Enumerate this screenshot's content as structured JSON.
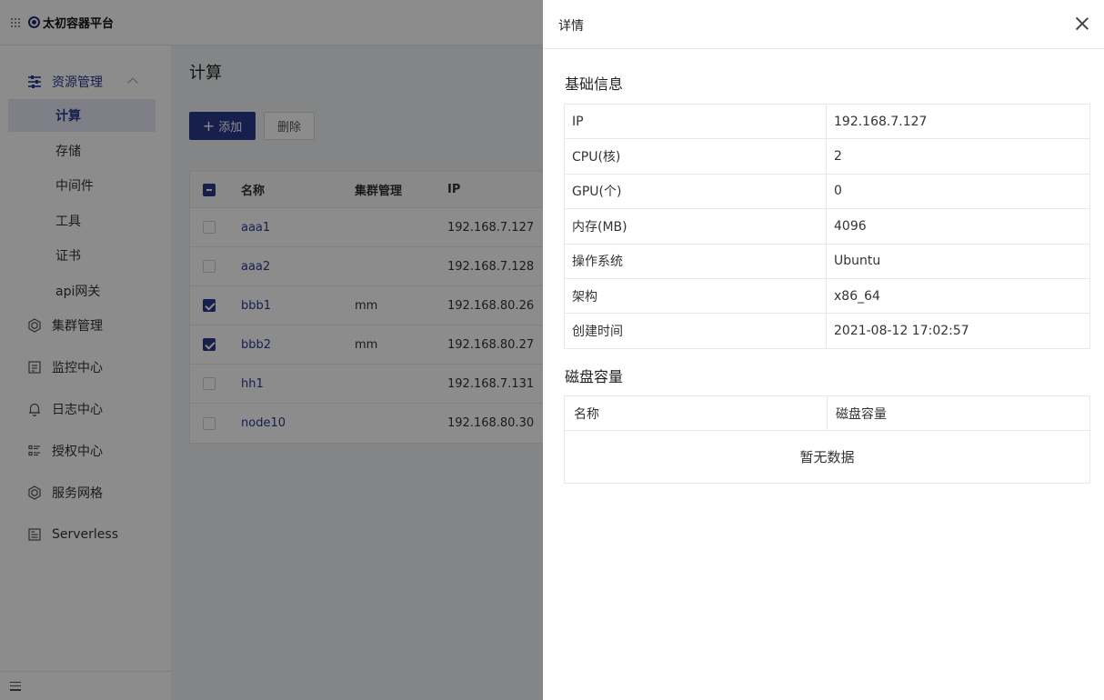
{
  "app": {
    "title": "太初容器平台"
  },
  "sidebar": {
    "groups": [
      {
        "label": "资源管理",
        "icon": "sliders-icon",
        "expanded": true
      },
      {
        "label": "集群管理",
        "icon": "hexagon-icon"
      },
      {
        "label": "监控中心",
        "icon": "monitor-icon"
      },
      {
        "label": "日志中心",
        "icon": "bell-icon"
      },
      {
        "label": "授权中心",
        "icon": "list-icon"
      },
      {
        "label": "服务网格",
        "icon": "hexagon-icon"
      },
      {
        "label": "Serverless",
        "icon": "document-icon"
      }
    ],
    "sub_items": [
      {
        "label": "计算",
        "active": true
      },
      {
        "label": "存储"
      },
      {
        "label": "中间件"
      },
      {
        "label": "工具"
      },
      {
        "label": "证书"
      },
      {
        "label": "api网关"
      }
    ]
  },
  "main": {
    "title": "计算",
    "add_button": "添加",
    "delete_button": "删除",
    "table": {
      "headers": [
        "名称",
        "集群管理",
        "IP"
      ],
      "rows": [
        {
          "name": "aaa1",
          "cluster": "",
          "ip": "192.168.7.127",
          "checked": false
        },
        {
          "name": "aaa2",
          "cluster": "",
          "ip": "192.168.7.128",
          "checked": false
        },
        {
          "name": "bbb1",
          "cluster": "mm",
          "ip": "192.168.80.26",
          "checked": true
        },
        {
          "name": "bbb2",
          "cluster": "mm",
          "ip": "192.168.80.27",
          "checked": true
        },
        {
          "name": "hh1",
          "cluster": "",
          "ip": "192.168.7.131",
          "checked": false
        },
        {
          "name": "node10",
          "cluster": "",
          "ip": "192.168.80.30",
          "checked": false
        }
      ]
    }
  },
  "drawer": {
    "title": "详情",
    "basic_title": "基础信息",
    "basic": [
      {
        "key": "IP",
        "value": "192.168.7.127"
      },
      {
        "key": "CPU(核)",
        "value": "2"
      },
      {
        "key": "GPU(个)",
        "value": "0"
      },
      {
        "key": "内存(MB)",
        "value": "4096"
      },
      {
        "key": "操作系统",
        "value": "Ubuntu"
      },
      {
        "key": "架构",
        "value": "x86_64"
      },
      {
        "key": "创建时间",
        "value": "2021-08-12 17:02:57"
      }
    ],
    "disk_title": "磁盘容量",
    "disk_headers": [
      "名称",
      "磁盘容量"
    ],
    "disk_empty": "暂无数据"
  },
  "colors": {
    "primary": "#2b3a8c",
    "mask": "rgba(0,0,0,0.45)"
  }
}
